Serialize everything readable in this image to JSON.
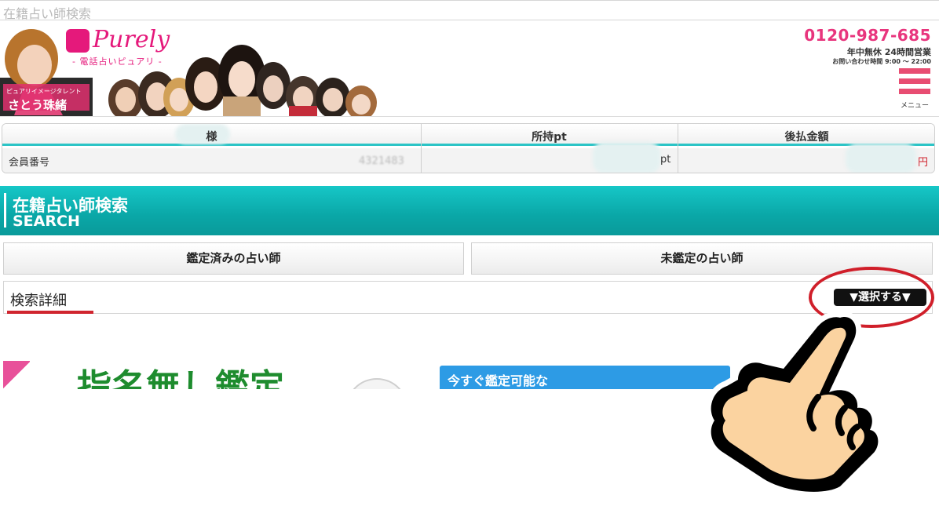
{
  "page_title": "在籍占い師検索",
  "header": {
    "logo_text": "Purely",
    "logo_sub": "- 電話占いピュアリ -",
    "talent_label": "ピュアリイメージタレント",
    "talent_name": "さとう珠緒",
    "phone": "0120-987-685",
    "hours": "年中無休 24時間営業",
    "hours_small": "お問い合わせ時間 9:00 〜 22:00",
    "menu_label": "メニュー"
  },
  "member": {
    "col_name_suffix": "様",
    "col_points": "所持pt",
    "col_postpaid": "後払金額",
    "member_no_label": "会員番号",
    "member_no_value": "4321483",
    "points_unit": "pt",
    "amount_unit": "円"
  },
  "section": {
    "title_jp": "在籍占い師検索",
    "title_en": "SEARCH"
  },
  "tabs": [
    {
      "label": "鑑定済みの占い師"
    },
    {
      "label": "未鑑定の占い師"
    }
  ],
  "search_detail": {
    "label": "検索詳細",
    "select_button": "▼選択する▼"
  },
  "banner": {
    "big_text": "指名無し鑑定",
    "blue_text": "今すぐ鑑定可能な"
  },
  "colors": {
    "brand_pink": "#e5197b",
    "teal": "#0aa7a7",
    "highlight_red": "#d01f2a"
  }
}
